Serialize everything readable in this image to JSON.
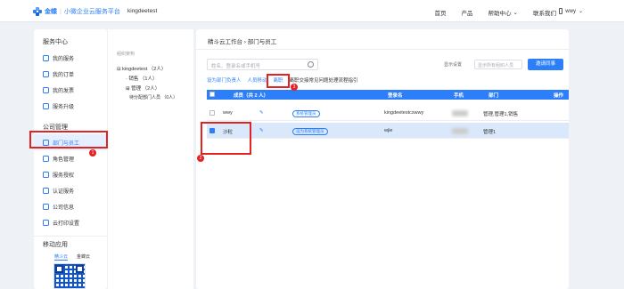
{
  "header": {
    "brand": "金蝶",
    "platform": "小微企业云服务平台",
    "tenant": "kingdeetest",
    "nav": [
      "首页",
      "产品",
      "帮助中心",
      "联系我们"
    ],
    "user": "wwy"
  },
  "sidebar": {
    "section1": "服务中心",
    "items1": [
      "我的服务",
      "我的订单",
      "我的发票",
      "服务升级"
    ],
    "section2": "公司管理",
    "items2": [
      "部门与员工",
      "角色管理",
      "服务授权",
      "认证服务",
      "公司信息",
      "云打印设置"
    ],
    "section3": "移动应用",
    "tabs": [
      "精斗云",
      "金蝶云"
    ]
  },
  "tree": {
    "title": "组织架构",
    "root": "kingdeetest （2人）",
    "children": [
      "销售 （1人）",
      "管理 （2人）",
      "待分配部门人员 （0人）"
    ]
  },
  "main": {
    "breadcrumb": "精斗云工作台 › 部门与员工",
    "search_placeholder": "姓名、登录名或手机号",
    "display_label": "显示设置",
    "display_select": "显示所有组织人员",
    "sync_button": "邀请同事",
    "actions": [
      "设为部门负责人",
      "人员移动",
      "离职"
    ],
    "actions_note": "离职交接常见问题处理流程指引",
    "columns": [
      "成员（共 2 人）",
      "登录名",
      "手机",
      "部门",
      "操作"
    ],
    "rows": [
      {
        "name": "wwy",
        "badge": "系统管理员",
        "login": "kingdeetestcswwy",
        "dept": "管理,管理1,销售"
      },
      {
        "name": "沙粒",
        "badge": "设为系统管理员",
        "login": "wjie",
        "dept": "管理1"
      }
    ]
  },
  "annotations": [
    "1",
    "2",
    "3"
  ]
}
